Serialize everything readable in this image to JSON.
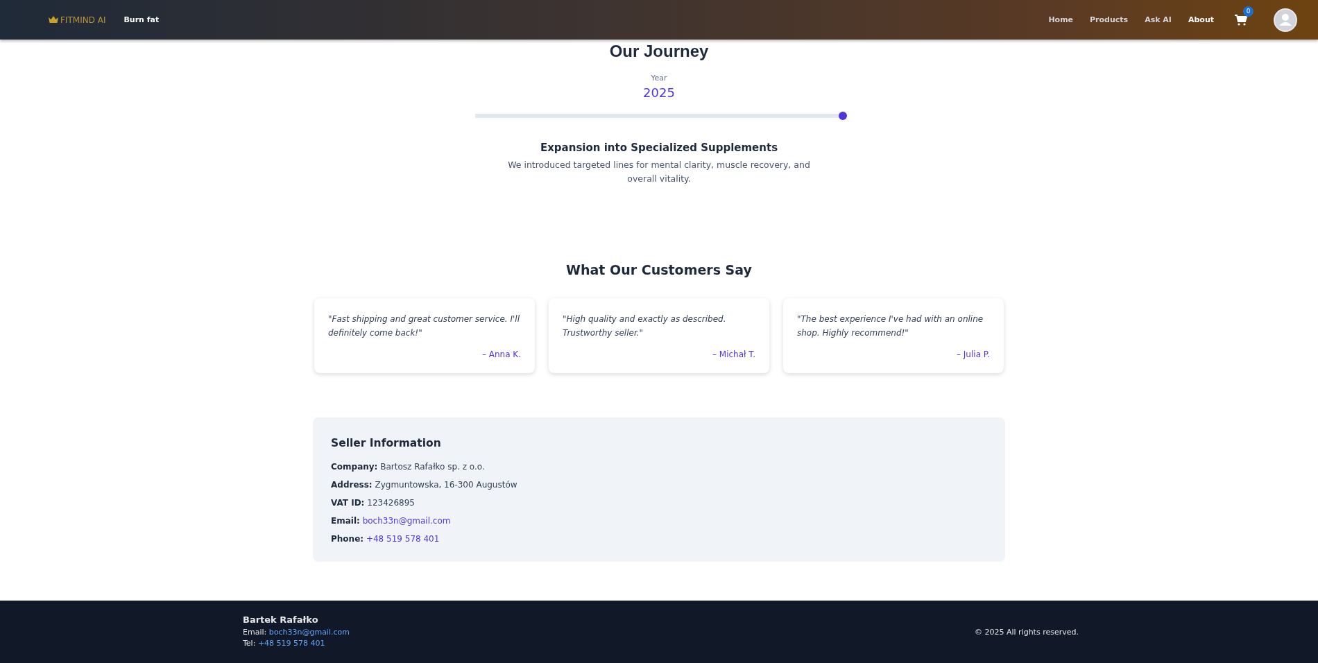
{
  "header": {
    "logo": "FITMIND AI",
    "tagline": "Burn fat",
    "nav": [
      {
        "label": "Home",
        "selected": false
      },
      {
        "label": "Products",
        "selected": false
      },
      {
        "label": "Ask AI",
        "selected": false
      },
      {
        "label": "About",
        "selected": true
      }
    ],
    "cart_count": "0"
  },
  "journey": {
    "title": "Our Journey",
    "year_label": "Year",
    "year": "2025",
    "level": 1,
    "milestone_title": "Expansion into Specialized Supplements",
    "milestone_text": "We introduced targeted lines for mental clarity, muscle recovery, and overall vitality."
  },
  "testimonials": {
    "title": "What Our Customers Say",
    "items": [
      {
        "quote": "\"Fast shipping and great customer service. I'll definitely come back!\"",
        "author": "– Anna K."
      },
      {
        "quote": "\"High quality and exactly as described. Trustworthy seller.\"",
        "author": "– Michał T."
      },
      {
        "quote": "\"The best experience I've had with an online shop. Highly recommend!\"",
        "author": "– Julia P."
      }
    ]
  },
  "seller": {
    "title": "Seller Information",
    "rows": [
      {
        "label": "Company:",
        "value": "Bartosz Rafałko sp. z o.o.",
        "kind": "text"
      },
      {
        "label": "Address:",
        "value": "Zygmuntowska, 16-300 Augustów",
        "kind": "text"
      },
      {
        "label": "VAT ID:",
        "value": "123426895",
        "kind": "text"
      },
      {
        "label": "Email:",
        "value": "boch33n@gmail.com",
        "kind": "link"
      },
      {
        "label": "Phone:",
        "value": "+48 519 578 401",
        "kind": "link"
      }
    ]
  },
  "footer": {
    "name": "Bartek Rafałko",
    "email_label": "Email:",
    "email": "boch33n@gmail.com",
    "tel_label": "Tel:",
    "tel": "+48 519 578 401",
    "copyright": "© 2025 All rights reserved."
  }
}
